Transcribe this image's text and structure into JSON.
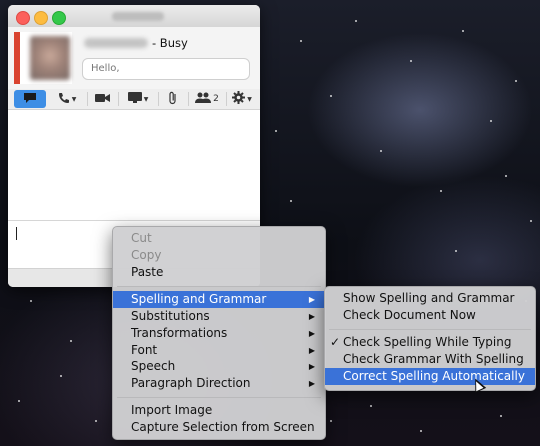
{
  "chat_window": {
    "status": "- Busy",
    "note_placeholder": "Hello,",
    "toolbar": {
      "participants_count": "2",
      "icons": [
        "message-icon",
        "phone-icon",
        "video-icon",
        "screen-share-icon",
        "attachment-icon",
        "participants-icon",
        "gear-icon"
      ]
    }
  },
  "context_menu": {
    "items": [
      {
        "label": "Cut",
        "state": "disabled"
      },
      {
        "label": "Copy",
        "state": "disabled"
      },
      {
        "label": "Paste",
        "state": "enabled"
      },
      {
        "label": "Spelling and Grammar",
        "state": "highlighted",
        "submenu": true
      },
      {
        "label": "Substitutions",
        "state": "enabled",
        "submenu": true
      },
      {
        "label": "Transformations",
        "state": "enabled",
        "submenu": true
      },
      {
        "label": "Font",
        "state": "enabled",
        "submenu": true
      },
      {
        "label": "Speech",
        "state": "enabled",
        "submenu": true
      },
      {
        "label": "Paragraph Direction",
        "state": "enabled",
        "submenu": true
      },
      {
        "label": "Import Image",
        "state": "enabled"
      },
      {
        "label": "Capture Selection from Screen",
        "state": "enabled"
      }
    ]
  },
  "spelling_submenu": {
    "items": [
      {
        "label": "Show Spelling and Grammar",
        "checked": false
      },
      {
        "label": "Check Document Now",
        "checked": false
      },
      {
        "label": "Check Spelling While Typing",
        "checked": true
      },
      {
        "label": "Check Grammar With Spelling",
        "checked": false
      },
      {
        "label": "Correct Spelling Automatically",
        "checked": false,
        "highlighted": true
      }
    ]
  },
  "colors": {
    "highlight": "#3a72d8",
    "toolbar_active": "#3d8ee5",
    "presence_busy": "#d9432f"
  }
}
